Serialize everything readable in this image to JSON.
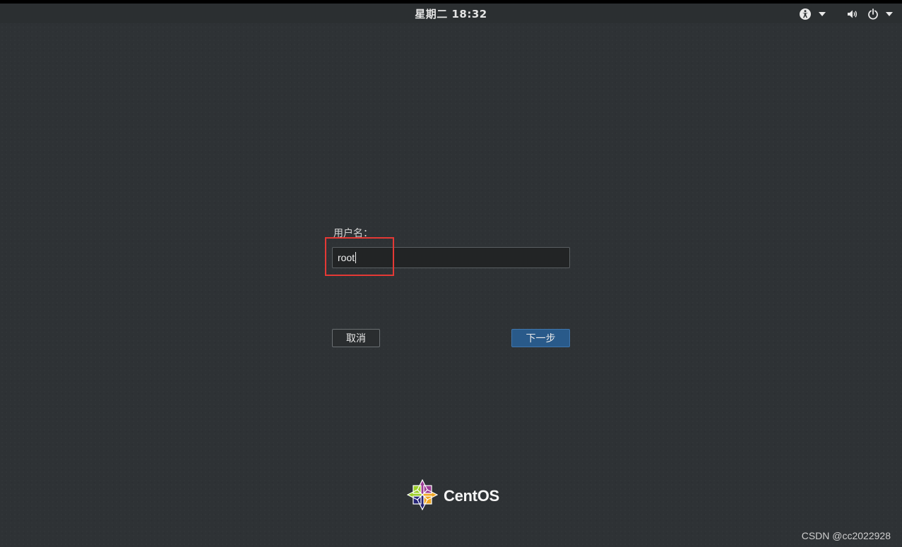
{
  "topbar": {
    "clock": "星期二 18:32",
    "icons": [
      "accessibility-icon",
      "chevron-down-icon",
      "volume-icon",
      "power-icon",
      "chevron-down-icon"
    ]
  },
  "login": {
    "label": "用户名：",
    "input_value": "root",
    "cancel_label": "取消",
    "next_label": "下一步"
  },
  "branding": {
    "logo_text": "CentOS"
  },
  "watermark": "CSDN @cc2022928",
  "colors": {
    "background": "#2e3235",
    "next_button": "#295a8a",
    "highlight_box": "#e53935"
  }
}
